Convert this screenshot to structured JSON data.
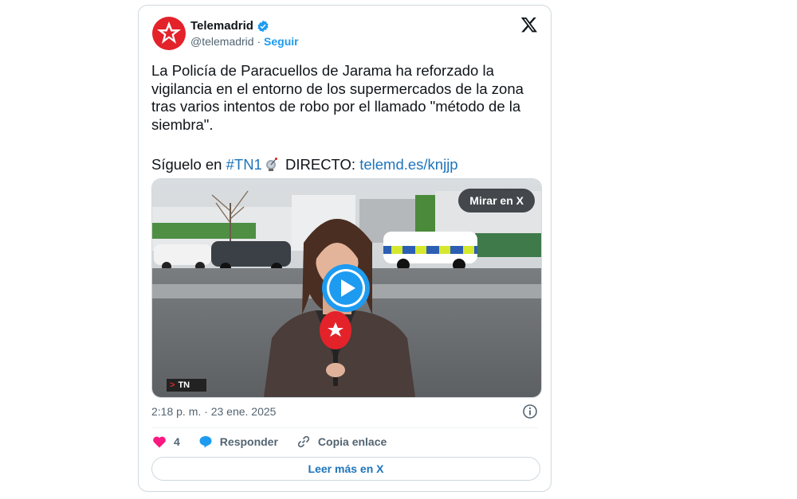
{
  "account": {
    "name": "Telemadrid",
    "handle": "@telemadrid",
    "separator": "·",
    "follow_label": "Seguir"
  },
  "tweet": {
    "text": "La Policía de Paracuellos de Jarama ha reforzado la vigilancia en el entorno de los supermercados de la zona tras varios intentos de robo por el llamado \"método de la siembra\".",
    "follow_prefix": "Síguelo en",
    "hashtag": "#TN1",
    "live_label": "DIRECTO:",
    "live_link": "telemd.es/knjjp"
  },
  "media": {
    "watch_label": "Mirar en X",
    "badge_text": "TN",
    "badge_arrow": ">"
  },
  "meta": {
    "timestamp": "2:18 p. m. · 23 ene. 2025"
  },
  "actions": {
    "like_count": "4",
    "reply_label": "Responder",
    "copy_label": "Copia enlace"
  },
  "read_more_label": "Leer más en X",
  "colors": {
    "accent": "#1d9bf0",
    "link": "#1d74bc",
    "like": "#f91880",
    "brand_red": "#e4222a"
  }
}
